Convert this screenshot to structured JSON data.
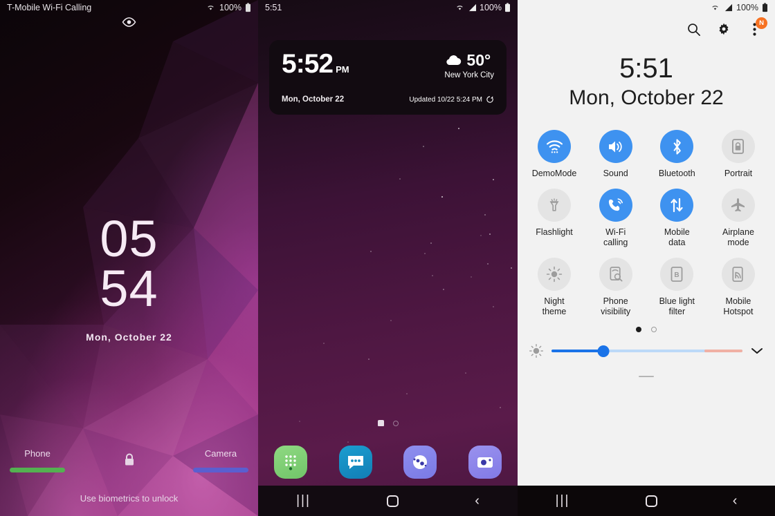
{
  "lock_screen": {
    "status_bar": {
      "carrier": "T-Mobile Wi-Fi Calling",
      "battery": "100%",
      "wifi_icon": "wifi-icon",
      "battery_icon": "battery-full-icon"
    },
    "eye_icon": "eye-icon",
    "clock": {
      "hours": "05",
      "minutes": "54",
      "date": "Mon, October 22"
    },
    "shortcuts": {
      "left_label": "Phone",
      "left_color": "#54b151",
      "right_label": "Camera",
      "right_color": "#5a5fd0",
      "lock_icon": "lock-icon"
    },
    "hint": "Use biometrics to unlock"
  },
  "home_screen": {
    "status_bar": {
      "time": "5:51",
      "battery": "100%",
      "wifi_icon": "wifi-icon",
      "signal_icon": "signal-icon",
      "battery_icon": "battery-full-icon"
    },
    "widget": {
      "time": "5:52",
      "ampm": "PM",
      "date": "Mon, October 22",
      "temperature": "50°",
      "weather_icon": "cloud-icon",
      "city": "New York City",
      "updated": "Updated 10/22 5:24 PM",
      "refresh_icon": "refresh-icon"
    },
    "page_indicator": {
      "pages": 2,
      "active": 0
    },
    "dock": [
      {
        "name": "phone-app-icon",
        "label": "Phone",
        "color": "#7fce75"
      },
      {
        "name": "messages-app-icon",
        "label": "Messages",
        "color": "#1790c4"
      },
      {
        "name": "internet-app-icon",
        "label": "Internet",
        "color": "#8484e8"
      },
      {
        "name": "camera-app-icon",
        "label": "Camera",
        "color": "#8d85ea"
      }
    ],
    "nav_bar": {
      "recents": "|||",
      "home": "home-square-icon",
      "back": "back-chevron-icon"
    }
  },
  "quick_settings": {
    "status_bar": {
      "battery": "100%",
      "wifi_icon": "wifi-icon",
      "signal_icon": "signal-icon",
      "battery_icon": "battery-full-icon"
    },
    "actions": [
      {
        "name": "search-icon",
        "label": "Search"
      },
      {
        "name": "gear-icon",
        "label": "Settings"
      },
      {
        "name": "overflow-menu-icon",
        "label": "More options",
        "badge": "N",
        "badge_color": "#f77222"
      }
    ],
    "clock": {
      "time": "5:51",
      "date": "Mon, October 22"
    },
    "tiles": [
      [
        {
          "label": "DemoMode",
          "icon": "wifi-icon",
          "state": "on"
        },
        {
          "label": "Sound",
          "icon": "sound-icon",
          "state": "on"
        },
        {
          "label": "Bluetooth",
          "icon": "bluetooth-icon",
          "state": "on"
        },
        {
          "label": "Portrait",
          "icon": "rotation-lock-icon",
          "state": "off"
        }
      ],
      [
        {
          "label": "Flashlight",
          "icon": "flashlight-icon",
          "state": "off"
        },
        {
          "label": "Wi-Fi\ncalling",
          "icon": "wifi-calling-icon",
          "state": "on"
        },
        {
          "label": "Mobile\ndata",
          "icon": "mobile-data-icon",
          "state": "on"
        },
        {
          "label": "Airplane\nmode",
          "icon": "airplane-icon",
          "state": "off"
        }
      ],
      [
        {
          "label": "Night\ntheme",
          "icon": "night-theme-icon",
          "state": "off"
        },
        {
          "label": "Phone\nvisibility",
          "icon": "phone-visibility-icon",
          "state": "off"
        },
        {
          "label": "Blue light\nfilter",
          "icon": "blue-light-filter-icon",
          "state": "off"
        },
        {
          "label": "Mobile\nHotspot",
          "icon": "hotspot-icon",
          "state": "off"
        }
      ]
    ],
    "page_indicator": {
      "pages": 2,
      "active": 0
    },
    "brightness": {
      "icon": "brightness-icon",
      "value_percent": 27,
      "expand_icon": "chevron-down-icon"
    },
    "nav_bar": {
      "recents": "|||",
      "home": "home-square-icon",
      "back": "back-chevron-icon"
    }
  },
  "colors": {
    "accent_blue": "#3e92f0",
    "tile_off": "#e4e4e4",
    "badge_orange": "#f77222",
    "qs_background": "#f2f2f2"
  }
}
